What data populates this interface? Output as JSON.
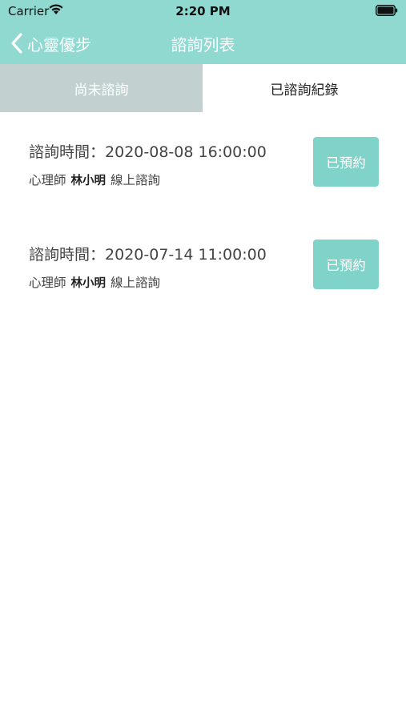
{
  "status_bar": {
    "carrier": "Carrier",
    "time": "2:20 PM"
  },
  "nav": {
    "back_label": "心靈優步",
    "title": "諮詢列表"
  },
  "tabs": [
    {
      "label": "尚未諮詢",
      "selected": false
    },
    {
      "label": "已諮詢紀錄",
      "selected": true
    }
  ],
  "records": [
    {
      "time_label": "諮詢時間：",
      "time_value": "2020-08-08 16:00:00",
      "role": "心理師",
      "name": "林小明",
      "mode": "線上諮詢",
      "button_label": "已預約"
    },
    {
      "time_label": "諮詢時間：",
      "time_value": "2020-07-14 11:00:00",
      "role": "心理師",
      "name": "林小明",
      "mode": "線上諮詢",
      "button_label": "已預約"
    }
  ],
  "colors": {
    "header_bg": "#8fd9d1",
    "tab_inactive_bg": "#c2d1cf",
    "button_bg": "#7fd3c9"
  },
  "icons": [
    "wifi-icon",
    "battery-icon",
    "chevron-left-icon"
  ]
}
